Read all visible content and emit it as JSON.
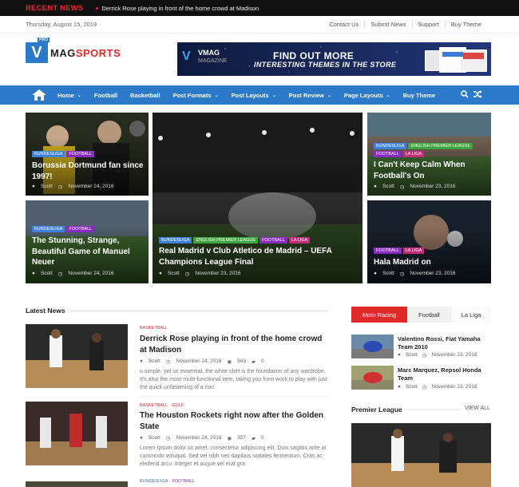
{
  "topbar": {
    "label": "RECENT NEWS",
    "ticker": "Derrick Rose playing in front of the home crowd at Madison"
  },
  "datebar": {
    "date": "Thursday, August 15, 2019",
    "links": [
      "Contact Us",
      "Submit News",
      "Support",
      "Buy Theme"
    ]
  },
  "logo": {
    "letter": "V",
    "pro": "PRO",
    "part1": "MAG",
    "part2": "SPORTS"
  },
  "banner": {
    "brand": "VMAG",
    "brand_sub": "MAGAZINE",
    "line1": "FIND OUT MORE",
    "line2": "INTERESTING THEMES IN THE STORE"
  },
  "nav": {
    "items": [
      {
        "label": "Home",
        "dd": true
      },
      {
        "label": "Football",
        "dd": false
      },
      {
        "label": "Basketball",
        "dd": false
      },
      {
        "label": "Post Formats",
        "dd": true
      },
      {
        "label": "Post Layouts",
        "dd": true
      },
      {
        "label": "Post Review",
        "dd": true
      },
      {
        "label": "Page Layouts",
        "dd": true
      },
      {
        "label": "Buy Theme",
        "dd": false
      }
    ]
  },
  "colors": {
    "accent": "#e02a2a",
    "nav": "#2c78c9",
    "bundesliga": "#3d82d8",
    "football": "#8a2cc0",
    "laliga": "#c0307a",
    "premier": "#3fa63f"
  },
  "featured": [
    {
      "title": "Borussia Dortmund fan since 1997!",
      "tags": [
        "BUNDESLIGA",
        "FOOTBALL"
      ],
      "author": "Scott",
      "date": "November 24, 2016"
    },
    {
      "title": "The Stunning, Strange, Beautiful Game of Manuel Neuer",
      "tags": [
        "BUNDESLIGA",
        "FOOTBALL"
      ],
      "author": "Scott",
      "date": "November 24, 2016"
    },
    {
      "title": "Real Madrid v Club Atletico de Madrid – UEFA Champions League Final",
      "tags": [
        "BUNDESLIGA",
        "ENGLISH PREMIER LEAGUE",
        "FOOTBALL",
        "LA LIGA"
      ],
      "author": "Scott",
      "date": "November 23, 2016"
    },
    {
      "title": "I Can't Keep Calm When Football's On",
      "tags": [
        "BUNDESLIGA",
        "ENGLISH PREMIER LEAGUE",
        "FOOTBALL",
        "LA LIGA"
      ],
      "author": "Scott",
      "date": "November 23, 2016"
    },
    {
      "title": "Hala Madrid on",
      "tags": [
        "FOOTBALL",
        "LA LIGA"
      ],
      "author": "Scott",
      "date": "November 23, 2016"
    }
  ],
  "latest": {
    "title": "Latest News",
    "posts": [
      {
        "cats": [
          "BASKETBALL"
        ],
        "title": "Derrick Rose playing in front of the home crowd at Madison",
        "author": "Scott",
        "date": "November 24, 2016",
        "views": "543",
        "comments": "0",
        "excerpt": "o simple, yet so essential, the white shirt is the foundation of any wardrobe. It's also the most multi-functional item, taking you from work to play with just the quick unfastening of a cou"
      },
      {
        "cats": [
          "BASKETBALL",
          "GOLF"
        ],
        "title": "The Houston Rockets right now after the Golden State",
        "author": "Scott",
        "date": "November 24, 2016",
        "views": "327",
        "comments": "0",
        "excerpt": "Lorem ipsum dolor sit amet, consectetur adipiscing elit. Duis sagittis ante at commodo volutpat. Sed vel nibh nec dapibus sodales fermentum. Cras ac eleifend arcu. Integer et augue vel erat gra"
      },
      {
        "cats": [
          "BUNDESLIGA",
          "FOOTBALL"
        ]
      }
    ]
  },
  "sidebar": {
    "tabs": [
      "Moto Racing",
      "Football",
      "La Liga"
    ],
    "items": [
      {
        "title": "Valentino Rossi, Fiat Yamaha Team 2010",
        "author": "Scott",
        "date": "November 23, 2016"
      },
      {
        "title": "Marc Marquez, Repsol Honda Team",
        "author": "Scott",
        "date": "November 23, 2016"
      }
    ],
    "premier": "Premier League",
    "view_all": "VIEW ALL"
  }
}
